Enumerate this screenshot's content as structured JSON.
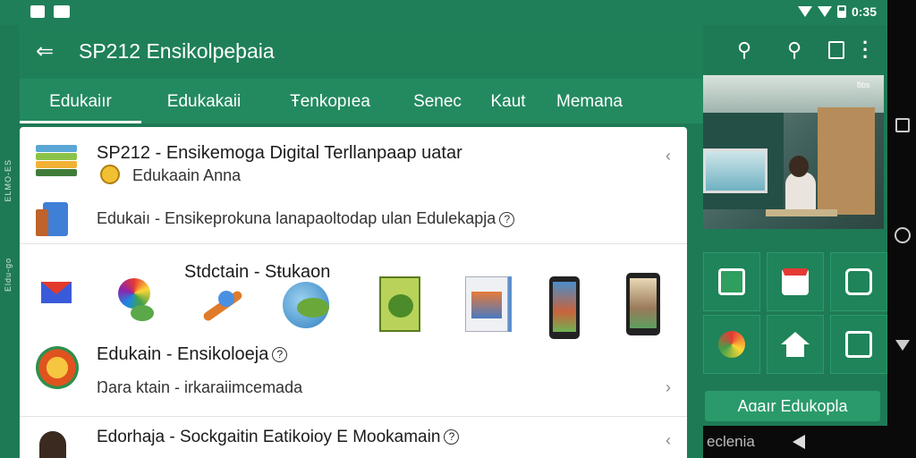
{
  "status_bar": {
    "time": "0:35"
  },
  "app_bar": {
    "title": "SP212  Ensikolpeþaia"
  },
  "tabs": [
    {
      "label": "Edukaiır"
    },
    {
      "label": "Edukakaii"
    },
    {
      "label": "Ŧenkopıea"
    },
    {
      "label": "Senec"
    },
    {
      "label": "Kaut"
    },
    {
      "label": "Memana"
    }
  ],
  "left_strip": {
    "top_text": "ELMO-ES",
    "bottom_text": "Eldu-go"
  },
  "list": {
    "item1": {
      "title": "SP212 - Ensikemoga Digital Terllanpaap uatar",
      "subtitle": "Edukaain Anna"
    },
    "item2": {
      "title": "Edukaiı - Ensikeprokuna lanapaoltodap ulan Edulekapja"
    },
    "item3": {
      "title": "Stdctain - Sŧukaon"
    },
    "item4": {
      "title": "Edukain - Ensikoloeja",
      "subtitle": "Ŋara ktain -   irkaraiimcemada"
    },
    "item5": {
      "title": "Edorhaja - Sockgaitin Eatikoioy E Mookamain"
    }
  },
  "right_panel": {
    "photo_label": "ƃbs",
    "button_label": "Aɑaır Edukopla",
    "bottom_text": "eclenia"
  }
}
